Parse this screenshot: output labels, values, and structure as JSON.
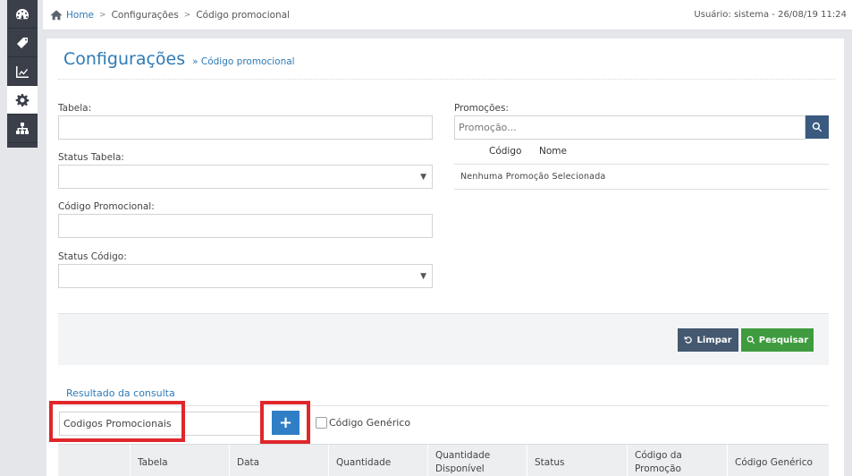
{
  "sidebar": {
    "items": [
      {
        "icon": "dashboard-icon"
      },
      {
        "icon": "tag-icon"
      },
      {
        "icon": "chart-icon"
      },
      {
        "icon": "gear-icon",
        "active": true
      },
      {
        "icon": "sitemap-icon"
      }
    ]
  },
  "breadcrumb": {
    "home": "Home",
    "items": [
      "Configurações",
      "Código promocional"
    ]
  },
  "user_info": "Usuário: sistema - 26/08/19 11:24",
  "page": {
    "title": "Configurações",
    "subtitle": "» Código promocional"
  },
  "form": {
    "tabela_label": "Tabela:",
    "tabela_value": "",
    "status_tabela_label": "Status Tabela:",
    "status_tabela_value": "",
    "codigo_label": "Código Promocional:",
    "codigo_value": "",
    "status_codigo_label": "Status Código:",
    "status_codigo_value": ""
  },
  "promocoes": {
    "label": "Promoções:",
    "placeholder": "Promoção...",
    "col_codigo": "Código",
    "col_nome": "Nome",
    "empty": "Nenhuma Promoção Selecionada"
  },
  "buttons": {
    "limpar": "Limpar",
    "pesquisar": "Pesquisar"
  },
  "results": {
    "link": "Resultado da consulta",
    "code_input_value": "Codigos Promocionais",
    "add_label": "+",
    "generic_label": "Código Genérico",
    "columns": [
      "",
      "Tabela",
      "Data",
      "Quantidade",
      "Quantidade Disponível",
      "Status",
      "Código da Promoção",
      "Código Genérico"
    ]
  },
  "colors": {
    "accent": "#2f7ab6",
    "sidebar": "#3a3f49",
    "limpar": "#44586f",
    "pesquisar": "#3f9b3f",
    "highlight": "#e0262b"
  }
}
